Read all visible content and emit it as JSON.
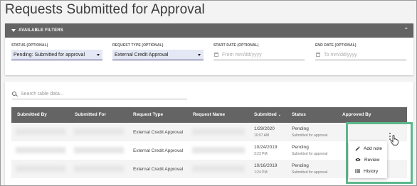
{
  "page": {
    "title": "Requests Submitted for Approval"
  },
  "filters": {
    "header": "AVAILABLE FILTERS",
    "status": {
      "label": "STATUS (OPTIONAL)",
      "value": "Pending: Submitted for approval"
    },
    "request_type": {
      "label": "REQUEST TYPE (OPTIONAL)",
      "value": "External Credit Approval"
    },
    "start_date": {
      "label": "START DATE (OPTIONAL)",
      "placeholder": "From mm/dd/yyyy"
    },
    "end_date": {
      "label": "END DATE (OPTIONAL)",
      "placeholder": "To mm/dd/yyyy"
    }
  },
  "table": {
    "search_placeholder": "Search table data...",
    "columns": [
      "Submitted By",
      "Submitted For",
      "Request Type",
      "Request Name",
      "Submitted",
      "Status",
      "Approved By"
    ],
    "sort_indicator": "⌄",
    "rows": [
      {
        "request_type": "External Credit Approval",
        "date": "1/29/2020",
        "time": "10:07 AM",
        "status": "Pending",
        "status_sub": "Submitted for approval"
      },
      {
        "request_type": "External Credit Approval",
        "date": "10/24/2019",
        "time": "3:23 PM",
        "status": "Pending",
        "status_sub": "Submitted for approval"
      },
      {
        "request_type": "External Credit Approval",
        "date": "10/16/2019",
        "time": "1:24 PM",
        "status": "Pending",
        "status_sub": "Submitted for approval"
      }
    ]
  },
  "action_menu": {
    "items": [
      {
        "label": "Add note",
        "icon": "pencil-icon"
      },
      {
        "label": "Review",
        "icon": "eye-icon"
      },
      {
        "label": "History",
        "icon": "list-icon"
      }
    ]
  },
  "colors": {
    "header_bar": "#646464",
    "select_bg": "#e4e8f4",
    "highlight": "#5cb88c"
  }
}
